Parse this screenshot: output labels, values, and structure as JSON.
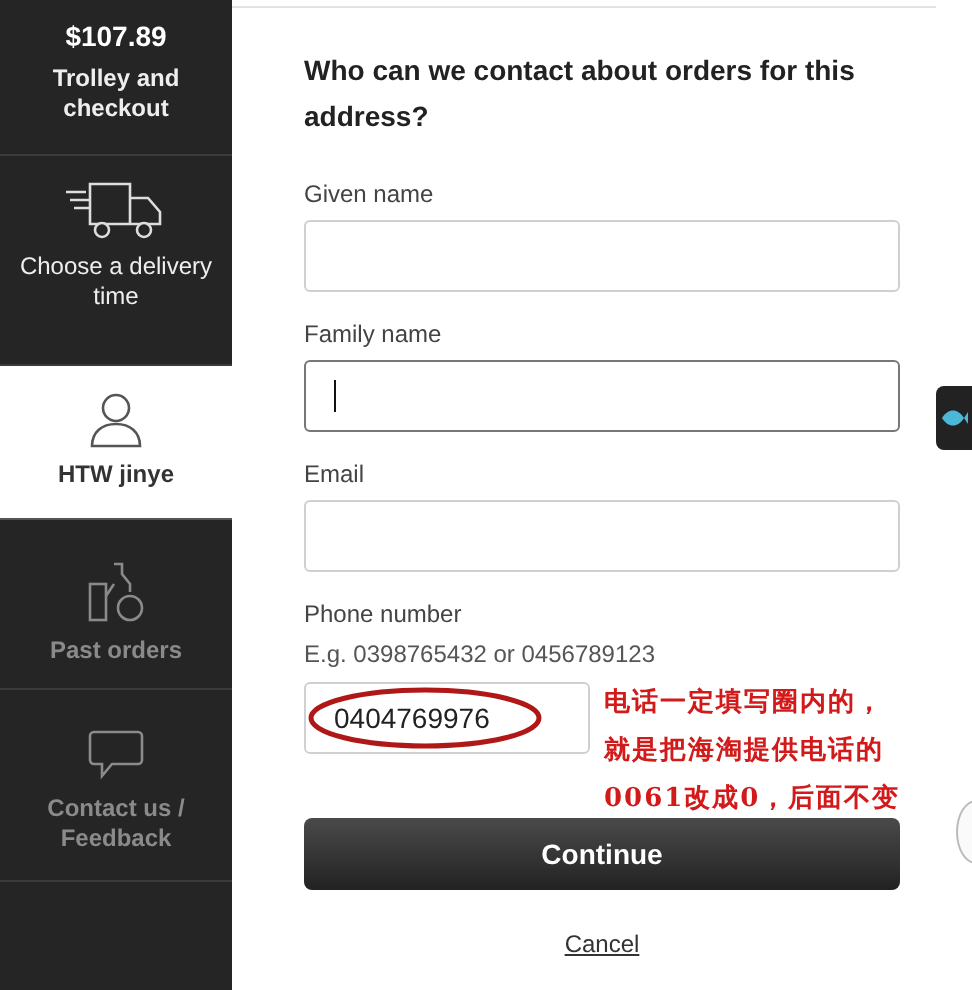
{
  "sidebar": {
    "items": [
      {
        "kind": "trolley",
        "price": "$107.89",
        "label": "Trolley and checkout",
        "selected": false,
        "disabled": false
      },
      {
        "kind": "delivery",
        "label": "Choose a delivery time",
        "selected": false,
        "disabled": false
      },
      {
        "kind": "account",
        "label": "HTW jinye",
        "selected": true,
        "disabled": false
      },
      {
        "kind": "orders",
        "label": "Past orders",
        "selected": false,
        "disabled": true
      },
      {
        "kind": "contact",
        "label": "Contact us / Feedback",
        "selected": false,
        "disabled": true
      }
    ]
  },
  "form": {
    "heading": "Who can we contact about orders for this address?",
    "fields": [
      {
        "label": "Given name",
        "focused": false
      },
      {
        "label": "Family name",
        "focused": true
      },
      {
        "label": "Email",
        "focused": false
      }
    ],
    "phone": {
      "label": "Phone number",
      "hint": "E.g.  0398765432 or 0456789123",
      "value": "0404769976"
    },
    "annotation": [
      "电话一定填写圈内的，",
      "就是把海淘提供电话的",
      "0061改成0，后面不变"
    ],
    "continue_button": "Continue",
    "cancel_link": "Cancel"
  }
}
